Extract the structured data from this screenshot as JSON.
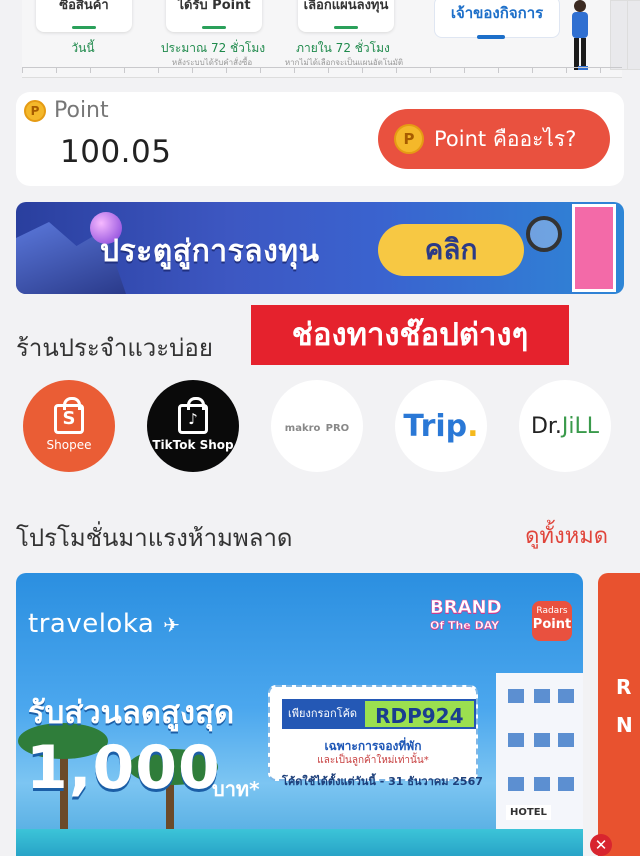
{
  "steps": [
    {
      "label": "ซื้อสินค้า",
      "time": "วันนี้",
      "note": ""
    },
    {
      "label": "ได้รับ Point",
      "time": "ประมาณ 72 ชั่วโมง",
      "note": "หลังระบบได้รับคำสั่งซื้อ"
    },
    {
      "label": "เลือกแผนลงทุน",
      "time": "ภายใน 72 ชั่วโมง",
      "note": "หากไม่ได้เลือกจะเป็นแผนอัตโนมัติ"
    },
    {
      "label": "เจ้าของกิจการ",
      "time": "",
      "note": ""
    }
  ],
  "points": {
    "coin_glyph": "P",
    "label": "Point",
    "value": "100.05",
    "what_label": "Point คืออะไร?"
  },
  "invest_banner": {
    "title": "ประตูสู่การลงทุน",
    "cta": "คลิก"
  },
  "shops": {
    "title": "ร้านประจำแวะบ่อย",
    "channels_badge": "ช่องทางช๊อปต่างๆ",
    "items": [
      {
        "name": "Shopee",
        "glyph": "S"
      },
      {
        "name": "TikTok Shop",
        "glyph": "♪"
      },
      {
        "name": "makro",
        "name2": "PRO"
      },
      {
        "name": "Trip",
        "dot": "."
      },
      {
        "name": "Dr.",
        "name2": "JiLL"
      }
    ]
  },
  "promotions": {
    "title": "โปรโมชั่นมาแรงห้ามพลาด",
    "see_all": "ดูทั้งหมด",
    "card": {
      "brand": "traveloka",
      "brand_of_day_1": "BRAND",
      "brand_of_day_2": "Of The DAY",
      "radars_1": "Radars",
      "radars_2": "Point",
      "headline": "รับส่วนลดสูงสุด",
      "amount": "1,000",
      "unit": "บาท*",
      "code_label": "เพียงกรอกโค้ด",
      "code": "RDP924",
      "condition_1": "เฉพาะการจองที่พัก",
      "condition_2": "และเป็นลูกค้าใหม่เท่านั้น*",
      "validity": "โค้ดใช้ได้ตั้งแต่วันนี้ - 31 ธันวาคม 2567",
      "hotel_sign": "HOTEL"
    },
    "peek_text": [
      "R",
      "N"
    ]
  },
  "close_glyph": "✕",
  "colors": {
    "accent_red": "#e9513f",
    "badge_red": "#e5222d",
    "link_red": "#e0453b",
    "step_blue": "#1d6fc9",
    "time_green": "#1f8a4c"
  }
}
